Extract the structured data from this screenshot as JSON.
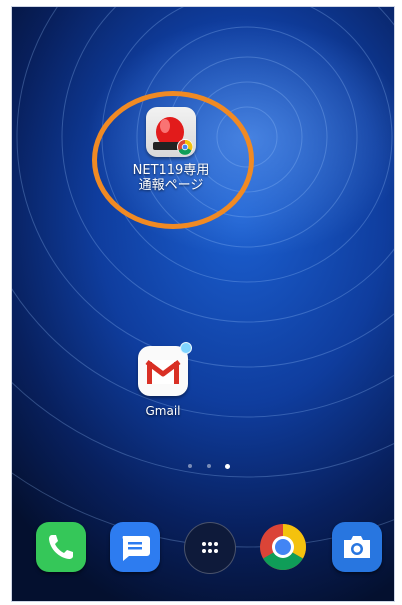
{
  "home_screen": {
    "apps": [
      {
        "name": "net119",
        "label_line1": "NET119専用",
        "label_line2": "通報ページ",
        "icon": "siren-icon"
      },
      {
        "name": "gmail",
        "label": "Gmail",
        "icon": "gmail-icon",
        "has_notification_badge": true
      }
    ],
    "page_indicator": {
      "page_count": 3,
      "current_page": 3
    },
    "dock": [
      {
        "name": "phone",
        "icon": "phone-icon",
        "color": "#35c759"
      },
      {
        "name": "messages",
        "icon": "message-icon",
        "color": "#2d7cf0"
      },
      {
        "name": "app-drawer",
        "icon": "grid-icon",
        "color": "#0e1a3a"
      },
      {
        "name": "chrome",
        "icon": "chrome-icon",
        "color": "#ffffff"
      },
      {
        "name": "camera",
        "icon": "camera-icon",
        "color": "#2876e0"
      }
    ],
    "highlight_ring_color": "#f08a24"
  }
}
